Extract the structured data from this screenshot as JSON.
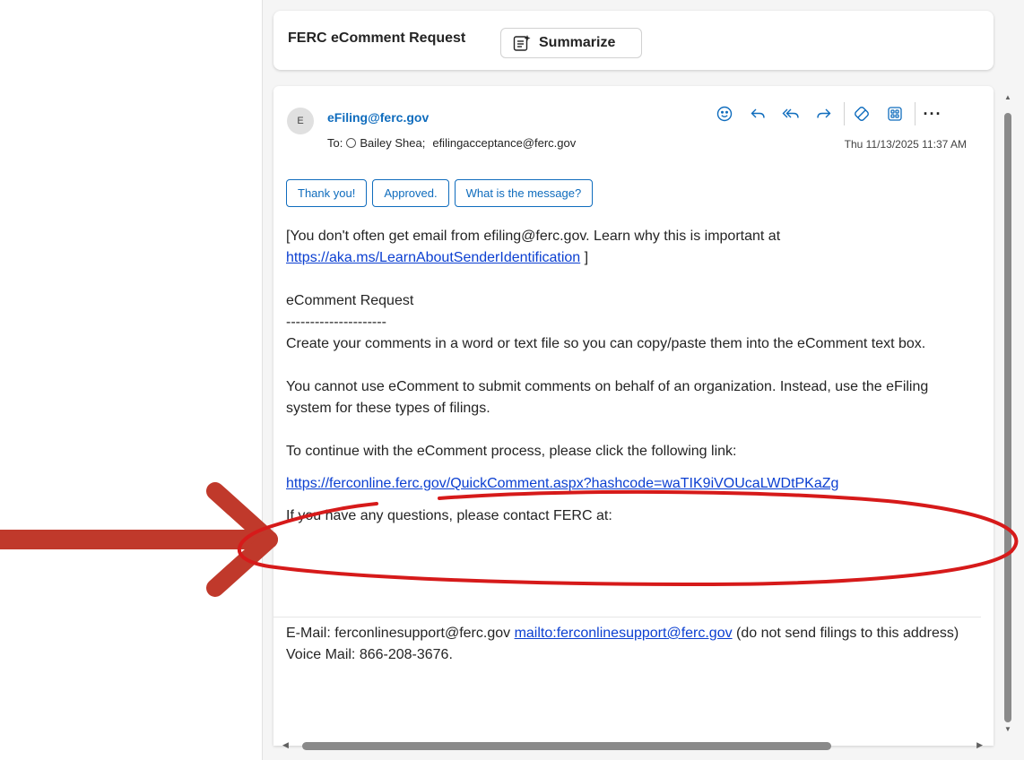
{
  "subject": {
    "title": "FERC eComment Request",
    "summarize_label": "Summarize"
  },
  "message": {
    "avatar_initial": "E",
    "sender": "eFiling@ferc.gov",
    "to_label": "To:",
    "recipient_1": "Bailey Shea;",
    "recipient_2": "efilingacceptance@ferc.gov",
    "date": "Thu 11/13/2025 11:37 AM",
    "more_label": "···"
  },
  "actions": {
    "icons": [
      "emoji-icon",
      "reply-icon",
      "reply-all-icon",
      "forward-icon",
      "copilot-icon",
      "apps-icon",
      "more-icon"
    ]
  },
  "quick_replies": [
    "Thank you!",
    "Approved.",
    "What is the message?"
  ],
  "body": {
    "warning_text": "[You don't often get email from efiling@ferc.gov. Learn why this is important at",
    "warning_link": "https://aka.ms/LearnAboutSenderIdentification",
    "warning_close": " ]",
    "heading": "eComment Request",
    "rule": "---------------------",
    "para1": "Create your comments in a word or text file so you can copy/paste them into the eComment text box.",
    "para2": "You cannot use eComment to submit comments on behalf of an organization. Instead, use the eFiling system for these types of filings.",
    "para3": "To continue with the eComment process, please click the following link:",
    "comment_link": "https://ferconline.ferc.gov/QuickComment.aspx?hashcode=waTIK9iVOUcaLWDtPKaZg",
    "para4": "If you have any questions, please contact FERC at:"
  },
  "footer": {
    "email_prefix": "E-Mail: ferconlinesupport@ferc.gov ",
    "mailto_link": "mailto:ferconlinesupport@ferc.gov",
    "email_suffix": " (do not send filings to this address)",
    "voicemail": "Voice Mail: 866-208-3676."
  },
  "colors": {
    "accent": "#0f6cbd",
    "link": "#0b3fd1",
    "annotation_red": "#cc1f1f",
    "arrow_red": "#c0392b"
  }
}
